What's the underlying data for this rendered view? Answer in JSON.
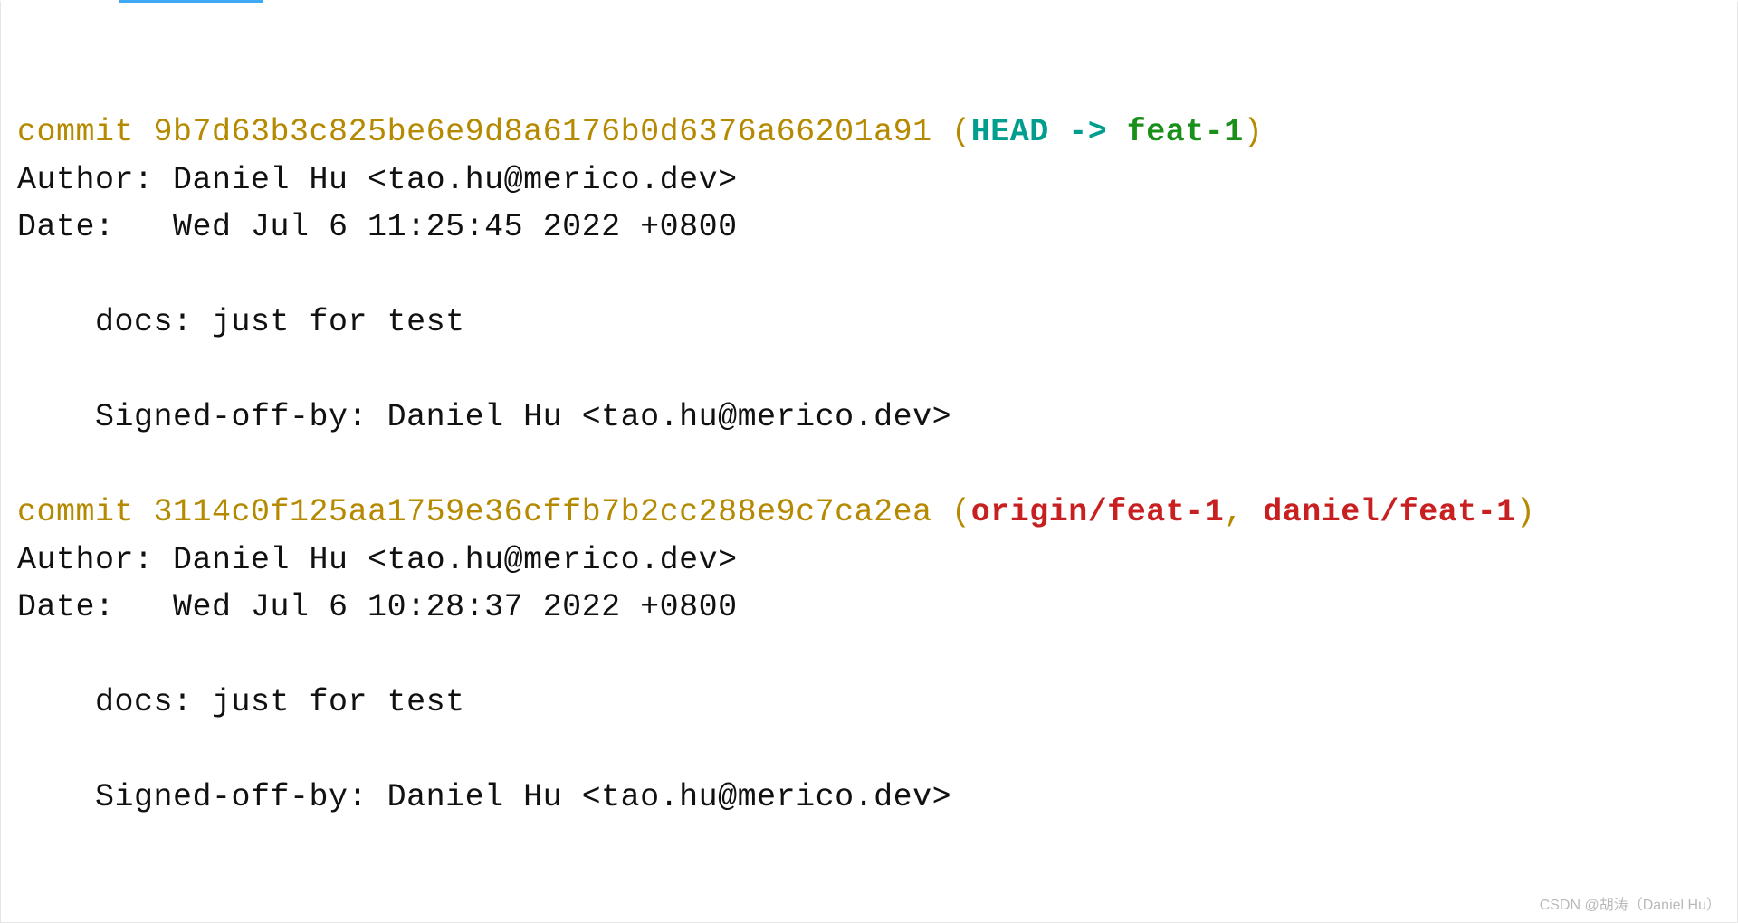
{
  "colors": {
    "commit_yellow": "#b58900",
    "teal": "#009e8e",
    "green": "#1a8f1a",
    "red": "#c82020"
  },
  "commits": [
    {
      "kw": "commit ",
      "hash": "9b7d63b3c825be6e9d8a6176b0d6376a66201a91",
      "ref_open": " (",
      "ref_close": ")",
      "ref_head": "HEAD -> ",
      "ref_branch": "feat-1",
      "author_line": "Author: Daniel Hu <tao.hu@merico.dev>",
      "date_line": "Date:   Wed Jul 6 11:25:45 2022 +0800",
      "msg_line": "    docs: just for test",
      "signoff_line": "    Signed-off-by: Daniel Hu <tao.hu@merico.dev>"
    },
    {
      "kw": "commit ",
      "hash": "3114c0f125aa1759e36cffb7b2cc288e9c7ca2ea",
      "ref_open": " (",
      "ref_close": ")",
      "ref_remote1": "origin/feat-1",
      "ref_sep": ", ",
      "ref_remote2": "daniel/feat-1",
      "author_line": "Author: Daniel Hu <tao.hu@merico.dev>",
      "date_line": "Date:   Wed Jul 6 10:28:37 2022 +0800",
      "msg_line": "    docs: just for test",
      "signoff_line": "    Signed-off-by: Daniel Hu <tao.hu@merico.dev>"
    }
  ],
  "watermark": "CSDN @胡涛（Daniel Hu）"
}
